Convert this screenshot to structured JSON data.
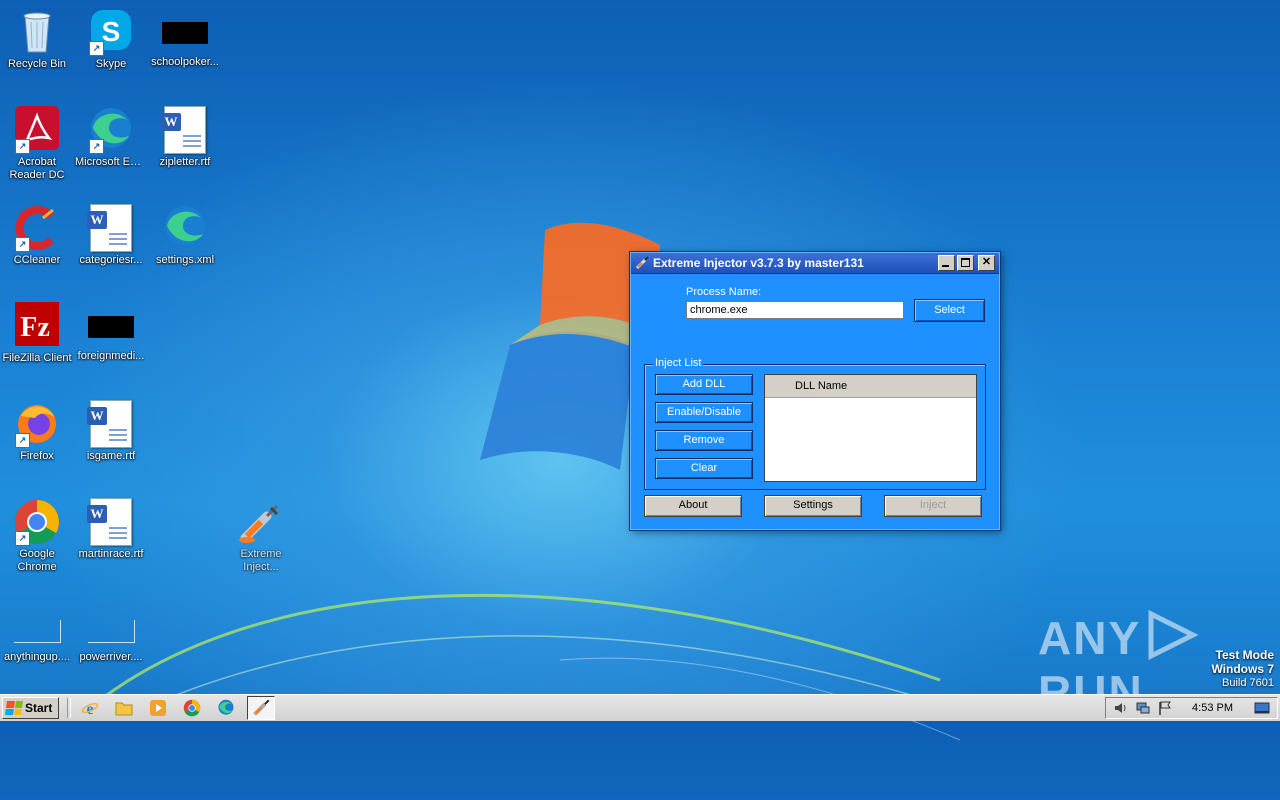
{
  "desktop": {
    "icons": [
      {
        "label": "Recycle Bin",
        "icon": "recycle-bin-icon"
      },
      {
        "label": "Skype",
        "icon": "skype-icon"
      },
      {
        "label": "schoolpoker...",
        "icon": "black-thumbnail-icon"
      },
      {
        "label": "Acrobat Reader DC",
        "icon": "acrobat-icon"
      },
      {
        "label": "Microsoft Edge",
        "icon": "edge-icon"
      },
      {
        "label": "zipletter.rtf",
        "icon": "word-doc-icon"
      },
      {
        "label": "CCleaner",
        "icon": "ccleaner-icon"
      },
      {
        "label": "categoriesr...",
        "icon": "word-doc-icon"
      },
      {
        "label": "settings.xml",
        "icon": "edge-icon"
      },
      {
        "label": "FileZilla Client",
        "icon": "filezilla-icon"
      },
      {
        "label": "foreignmedi...",
        "icon": "black-thumbnail-icon"
      },
      {
        "label": "Firefox",
        "icon": "firefox-icon"
      },
      {
        "label": "isgame.rtf",
        "icon": "word-doc-icon"
      },
      {
        "label": "Google Chrome",
        "icon": "chrome-icon"
      },
      {
        "label": "martinrace.rtf",
        "icon": "word-doc-icon"
      },
      {
        "label": "Extreme Inject...",
        "icon": "syringe-icon"
      },
      {
        "label": "anythingup....",
        "icon": "blank-thumbnail-icon"
      },
      {
        "label": "powerriver....",
        "icon": "blank-thumbnail-icon"
      }
    ]
  },
  "window": {
    "title": "Extreme Injector v3.7.3 by master131",
    "process_label": "Process Name:",
    "process_value": "chrome.exe",
    "select_button": "Select",
    "inject_list_legend": "Inject List",
    "add_dll_button": "Add DLL",
    "enable_disable_button": "Enable/Disable",
    "remove_button": "Remove",
    "clear_button": "Clear",
    "dll_column_header": "DLL Name",
    "about_button": "About",
    "settings_button": "Settings",
    "inject_button": "Inject"
  },
  "watermark": {
    "text_left": "ANY",
    "text_right": "RUN",
    "test_mode": "Test Mode",
    "os": "Windows 7",
    "build": "Build 7601"
  },
  "taskbar": {
    "start_label": "Start",
    "clock": "4:53 PM",
    "pinned": [
      "internet-explorer-icon",
      "file-explorer-icon",
      "media-player-icon",
      "chrome-icon",
      "edge-icon",
      "extreme-injector-icon"
    ]
  },
  "colors": {
    "window_bg": "#1e90ff",
    "titlebar": "#1f52b8",
    "desktop": "#1a7fd2"
  }
}
